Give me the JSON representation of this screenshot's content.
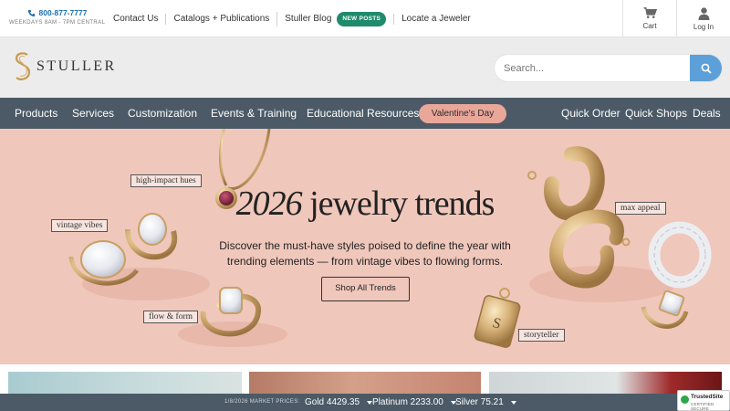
{
  "topbar": {
    "phone": "800-877-7777",
    "hours": "WEEKDAYS 8AM - 7PM CENTRAL",
    "links": [
      "Contact Us",
      "Catalogs + Publications",
      "Stuller Blog",
      "Locate a Jeweler"
    ],
    "blog_badge": "NEW POSTS",
    "cart_label": "Cart",
    "login_label": "Log In"
  },
  "header": {
    "logo": "STULLER",
    "search_placeholder": "Search..."
  },
  "nav": {
    "left": [
      "Products",
      "Services",
      "Customization",
      "Events & Training",
      "Educational Resources"
    ],
    "promo": "Valentine's Day",
    "right": [
      "Quick Order",
      "Quick Shops",
      "Deals"
    ]
  },
  "hero": {
    "title_number": "2026",
    "title_text": "jewelry trends",
    "subtitle": "Discover the must-have styles poised to define the year with trending elements — from vintage vibes to flowing forms.",
    "cta": "Shop All Trends",
    "tags": [
      "high-impact hues",
      "vintage vibes",
      "flow & form",
      "max appeal",
      "storyteller"
    ]
  },
  "market": {
    "date": "1/8/2026 MARKET PRICES:",
    "gold": "Gold 4429.35",
    "platinum": "Platinum 2233.00",
    "silver": "Silver 75.21"
  },
  "trusted": {
    "name": "TrustedSite",
    "sub": "CERTIFIED SECURE"
  },
  "colors": {
    "nav": "#4b5a66",
    "hero_bg": "#f0c7bb",
    "accent_blue": "#5d9fd8",
    "badge_green": "#1f8a6c",
    "valentine": "#e9a79a"
  }
}
